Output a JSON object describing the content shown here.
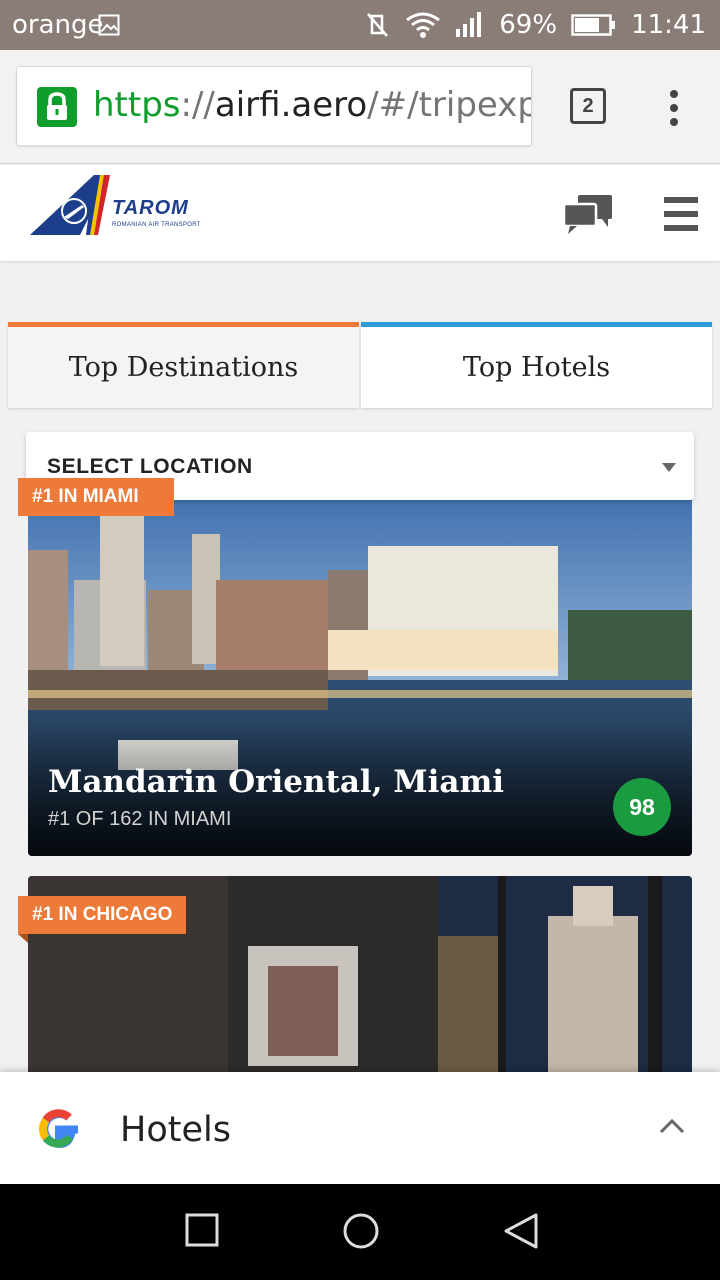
{
  "status_bar": {
    "carrier": "orange",
    "battery": "69%",
    "time": "11:41"
  },
  "browser": {
    "url_scheme": "https",
    "url_sep": "://",
    "url_host": "airfi.aero",
    "url_rest": "/#/tripexpe",
    "tab_count": "2"
  },
  "site": {
    "logo_wordmark": "TAROM",
    "logo_tagline": "ROMANIAN AIR TRANSPORT"
  },
  "tabs": {
    "left": "Top Destinations",
    "right": "Top Hotels"
  },
  "select": {
    "label": "SELECT LOCATION"
  },
  "cards": [
    {
      "ribbon": "#1 IN MIAMI",
      "title": "Mandarin Oriental, Miami",
      "subtitle": "#1 OF 162 IN MIAMI",
      "score": "98"
    },
    {
      "ribbon": "#1 IN CHICAGO"
    }
  ],
  "google_bar": {
    "label": "Hotels"
  },
  "colors": {
    "accent_orange": "#ee7a3a",
    "accent_blue": "#2f9ad8",
    "score_green": "#1b9b3f",
    "https_green": "#0f9d2c"
  }
}
